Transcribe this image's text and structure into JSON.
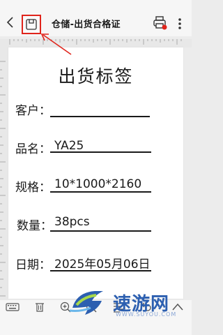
{
  "topbar": {
    "title": "仓储-出货合格证",
    "back_icon": "chevron-left-icon",
    "app_icon": "save-icon",
    "printer_icon": "printer-icon",
    "more_icon": "more-vertical-icon"
  },
  "colors": {
    "highlight": "#e0241b",
    "accent_blue": "#2c5fb0"
  },
  "label": {
    "title": "出货标签",
    "rows": [
      {
        "label": "客户：",
        "value": ""
      },
      {
        "label": "品名：",
        "value": "YA25"
      },
      {
        "label": "规格：",
        "value": "10*1000*2160"
      },
      {
        "label": "数量：",
        "value": "38pcs"
      },
      {
        "label": "日期：",
        "value": "2025年05月06日"
      }
    ]
  },
  "watermark": {
    "text": "速游网",
    "sub": "WWW.SUYOU.COM"
  },
  "bottom_toolbar": [
    {
      "icon": "keyboard-icon"
    },
    {
      "icon": "trash-icon"
    },
    {
      "icon": "zoom-in-icon"
    },
    {
      "icon": "zoom-out-icon"
    },
    {
      "icon": "align-icon"
    },
    {
      "icon": "undo-icon"
    },
    {
      "icon": "chevron-up-icon"
    }
  ]
}
